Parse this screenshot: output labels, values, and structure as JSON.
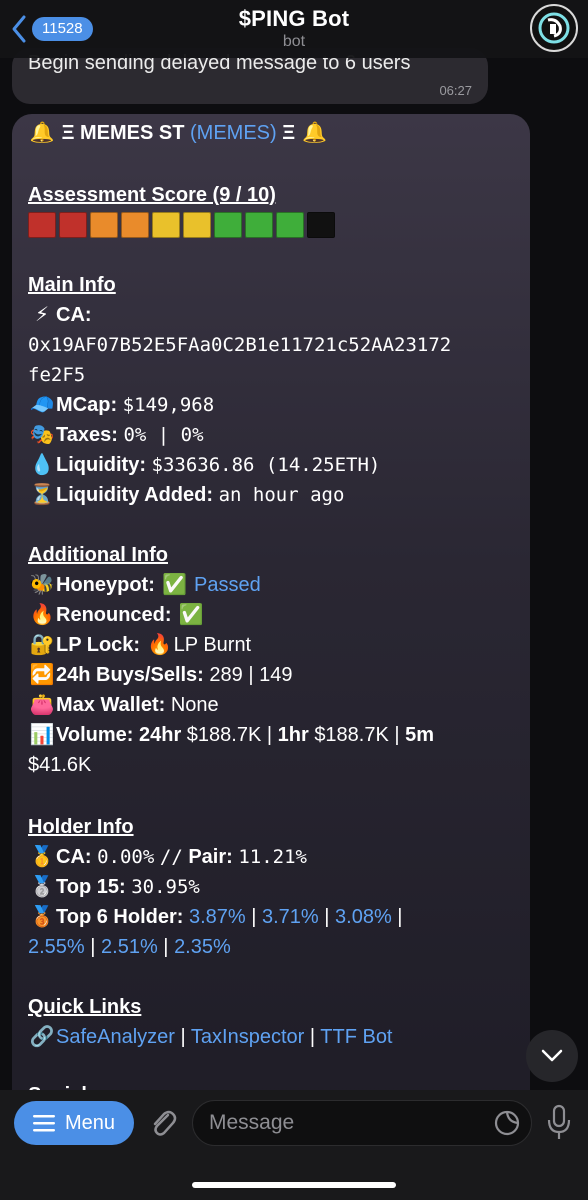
{
  "header": {
    "back_count": "11528",
    "title": "$PING Bot",
    "subtitle": "bot"
  },
  "previous_message": {
    "text": "Begin sending delayed message to 6 users",
    "time": "06:27"
  },
  "message": {
    "title_prefix": "Ξ MEMES ST",
    "title_ticker": "(MEMES)",
    "title_suffix": "Ξ",
    "assessment_label": "Assessment Score (9 / 10)",
    "score_colors": [
      "#c0312b",
      "#c0312b",
      "#e98b2b",
      "#e98b2b",
      "#e9c12b",
      "#e9c12b",
      "#3fae3a",
      "#3fae3a",
      "#3fae3a",
      "#111111"
    ],
    "main_info": {
      "heading": "Main Info",
      "ca_label": "CA:",
      "ca_line1": "0x19AF07B52E5FAa0C2B1e11721c52AA23172",
      "ca_line2": "fe2F5",
      "mcap_label": "MCap:",
      "mcap_value": "$149,968",
      "taxes_label": "Taxes:",
      "taxes_value": "0% | 0%",
      "liquidity_label": "Liquidity:",
      "liquidity_value": "$33636.86 (14.25ETH)",
      "liq_added_label": "Liquidity Added:",
      "liq_added_value": "an hour ago"
    },
    "additional_info": {
      "heading": "Additional Info",
      "honeypot_label": "Honeypot:",
      "honeypot_value": "Passed",
      "renounced_label": "Renounced:",
      "lplock_label": "LP Lock:",
      "lplock_value": "LP Burnt",
      "buys_sells_label": "24h Buys/Sells:",
      "buys_sells_value": "289 | 149",
      "max_wallet_label": "Max Wallet:",
      "max_wallet_value": "None",
      "volume_label": "Volume:",
      "volume_24hr_label": "24hr",
      "volume_24hr_value": "$188.7K",
      "volume_1hr_label": "1hr",
      "volume_1hr_value": "$188.7K",
      "volume_5m_label": "5m",
      "volume_5m_value": "$41.6K"
    },
    "holder_info": {
      "heading": "Holder Info",
      "ca_label": "CA:",
      "ca_value": "0.00%",
      "pair_label": "Pair:",
      "pair_value": "11.21%",
      "top15_label": "Top 15:",
      "top15_value": "30.95%",
      "top6_label": "Top 6 Holder:",
      "top6_values": [
        "3.87%",
        "3.71%",
        "3.08%",
        "2.55%",
        "2.51%",
        "2.35%"
      ]
    },
    "quick_links": {
      "heading": "Quick Links",
      "links": [
        "SafeAnalyzer",
        "TaxInspector",
        "TTF Bot"
      ]
    },
    "next_heading_partial": "Social"
  },
  "bottom": {
    "menu_label": "Menu",
    "input_placeholder": "Message"
  },
  "colors": {
    "accent": "#4b8fe6",
    "link": "#5fa2f2"
  }
}
